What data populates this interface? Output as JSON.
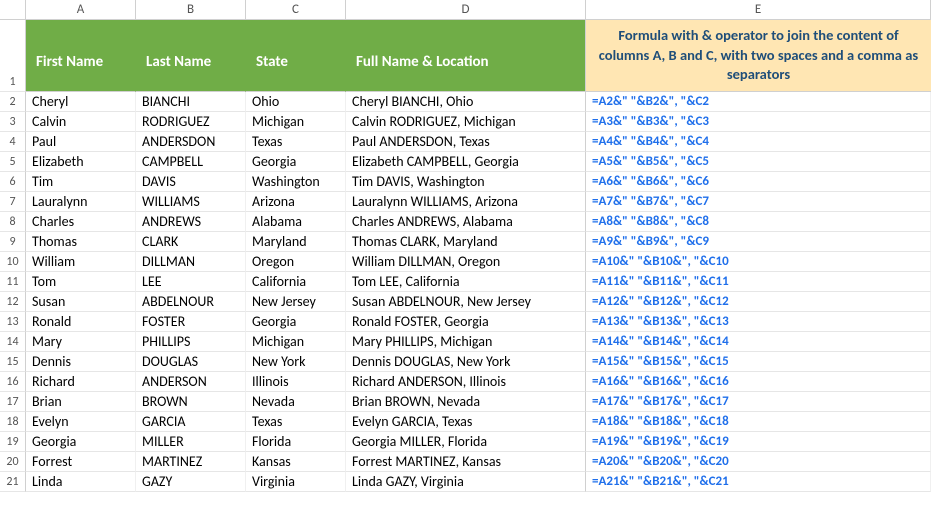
{
  "columns": [
    "A",
    "B",
    "C",
    "D",
    "E"
  ],
  "headers": {
    "first_name": "First Name",
    "last_name": "Last Name",
    "state": "State",
    "full": "Full Name & Location",
    "formula_note": "Formula with & operator to join the content of columns A, B and C, with two spaces and a comma as separators"
  },
  "rows": [
    {
      "n": "2",
      "a": "Cheryl",
      "b": "BIANCHI",
      "c": "Ohio",
      "d": "Cheryl BIANCHI, Ohio",
      "e": "=A2&\"  \"&B2&\",  \"&C2"
    },
    {
      "n": "3",
      "a": "Calvin",
      "b": "RODRIGUEZ",
      "c": "Michigan",
      "d": "Calvin RODRIGUEZ, Michigan",
      "e": "=A3&\"  \"&B3&\",  \"&C3"
    },
    {
      "n": "4",
      "a": "Paul",
      "b": "ANDERSDON",
      "c": "Texas",
      "d": "Paul ANDERSDON, Texas",
      "e": "=A4&\"  \"&B4&\",  \"&C4"
    },
    {
      "n": "5",
      "a": "Elizabeth",
      "b": "CAMPBELL",
      "c": "Georgia",
      "d": "Elizabeth CAMPBELL, Georgia",
      "e": "=A5&\"  \"&B5&\",  \"&C5"
    },
    {
      "n": "6",
      "a": "Tim",
      "b": "DAVIS",
      "c": "Washington",
      "d": "Tim DAVIS, Washington",
      "e": "=A6&\"  \"&B6&\",  \"&C6"
    },
    {
      "n": "7",
      "a": "Lauralynn",
      "b": "WILLIAMS",
      "c": "Arizona",
      "d": "Lauralynn WILLIAMS, Arizona",
      "e": "=A7&\"  \"&B7&\",  \"&C7"
    },
    {
      "n": "8",
      "a": "Charles",
      "b": "ANDREWS",
      "c": "Alabama",
      "d": "Charles ANDREWS, Alabama",
      "e": "=A8&\"  \"&B8&\",  \"&C8"
    },
    {
      "n": "9",
      "a": "Thomas",
      "b": "CLARK",
      "c": "Maryland",
      "d": "Thomas CLARK, Maryland",
      "e": "=A9&\"  \"&B9&\",  \"&C9"
    },
    {
      "n": "10",
      "a": "William",
      "b": "DILLMAN",
      "c": "Oregon",
      "d": "William DILLMAN, Oregon",
      "e": "=A10&\"  \"&B10&\",  \"&C10"
    },
    {
      "n": "11",
      "a": "Tom",
      "b": "LEE",
      "c": "California",
      "d": "Tom LEE, California",
      "e": "=A11&\"  \"&B11&\",  \"&C11"
    },
    {
      "n": "12",
      "a": "Susan",
      "b": "ABDELNOUR",
      "c": "New Jersey",
      "d": "Susan ABDELNOUR, New Jersey",
      "e": "=A12&\"  \"&B12&\",  \"&C12"
    },
    {
      "n": "13",
      "a": "Ronald",
      "b": "FOSTER",
      "c": "Georgia",
      "d": "Ronald FOSTER, Georgia",
      "e": "=A13&\"  \"&B13&\",  \"&C13"
    },
    {
      "n": "14",
      "a": "Mary",
      "b": "PHILLIPS",
      "c": "Michigan",
      "d": "Mary PHILLIPS, Michigan",
      "e": "=A14&\"  \"&B14&\",  \"&C14"
    },
    {
      "n": "15",
      "a": "Dennis",
      "b": "DOUGLAS",
      "c": "New York",
      "d": "Dennis DOUGLAS, New York",
      "e": "=A15&\"  \"&B15&\",  \"&C15"
    },
    {
      "n": "16",
      "a": "Richard",
      "b": "ANDERSON",
      "c": "Illinois",
      "d": "Richard ANDERSON, Illinois",
      "e": "=A16&\"  \"&B16&\",  \"&C16"
    },
    {
      "n": "17",
      "a": "Brian",
      "b": "BROWN",
      "c": "Nevada",
      "d": "Brian BROWN, Nevada",
      "e": "=A17&\"  \"&B17&\",  \"&C17"
    },
    {
      "n": "18",
      "a": "Evelyn",
      "b": "GARCIA",
      "c": "Texas",
      "d": "Evelyn GARCIA, Texas",
      "e": "=A18&\"  \"&B18&\",  \"&C18"
    },
    {
      "n": "19",
      "a": "Georgia",
      "b": "MILLER",
      "c": "Florida",
      "d": "Georgia MILLER, Florida",
      "e": "=A19&\"  \"&B19&\",  \"&C19"
    },
    {
      "n": "20",
      "a": "Forrest",
      "b": "MARTINEZ",
      "c": "Kansas",
      "d": "Forrest MARTINEZ, Kansas",
      "e": "=A20&\"  \"&B20&\",  \"&C20"
    },
    {
      "n": "21",
      "a": "Linda",
      "b": "GAZY",
      "c": "Virginia",
      "d": "Linda GAZY, Virginia",
      "e": "=A21&\"  \"&B21&\",  \"&C21"
    }
  ]
}
